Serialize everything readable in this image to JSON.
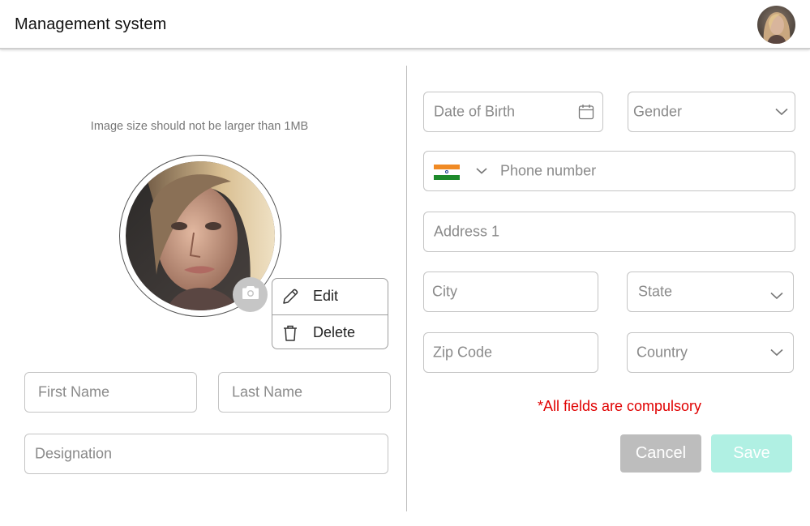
{
  "header": {
    "title": "Management system",
    "avatar_icon": "user-avatar"
  },
  "profile": {
    "hint": "Image size should not be larger than 1MB",
    "photo_icon": "profile-photo",
    "camera_icon": "camera-icon",
    "menu": {
      "edit_label": "Edit",
      "edit_icon": "pencil-icon",
      "delete_label": "Delete",
      "delete_icon": "trash-icon"
    }
  },
  "form": {
    "first_name": {
      "value": "",
      "placeholder": "First Name"
    },
    "last_name": {
      "value": "",
      "placeholder": "Last Name"
    },
    "designation": {
      "value": "",
      "placeholder": "Designation"
    },
    "dob": {
      "value": "",
      "placeholder": "Date of Birth",
      "icon": "calendar-icon"
    },
    "gender": {
      "selected": "",
      "placeholder": "Gender",
      "icon": "chevron-down-icon"
    },
    "phone": {
      "value": "",
      "placeholder": "Phone number",
      "country_flag": "india-flag",
      "icon": "chevron-down-icon"
    },
    "address1": {
      "value": "",
      "placeholder": "Address 1"
    },
    "city": {
      "value": "",
      "placeholder": "City"
    },
    "state": {
      "selected": "",
      "placeholder": "State",
      "icon": "chevron-down-icon"
    },
    "zip": {
      "value": "",
      "placeholder": "Zip Code"
    },
    "country": {
      "selected": "",
      "placeholder": "Country",
      "icon": "chevron-down-icon"
    },
    "notice": "*All fields are compulsory"
  },
  "actions": {
    "cancel_label": "Cancel",
    "save_label": "Save"
  },
  "colors": {
    "notice": "#e00000",
    "cancel_bg": "#bdbdbd",
    "save_bg": "#b0f0e3"
  }
}
